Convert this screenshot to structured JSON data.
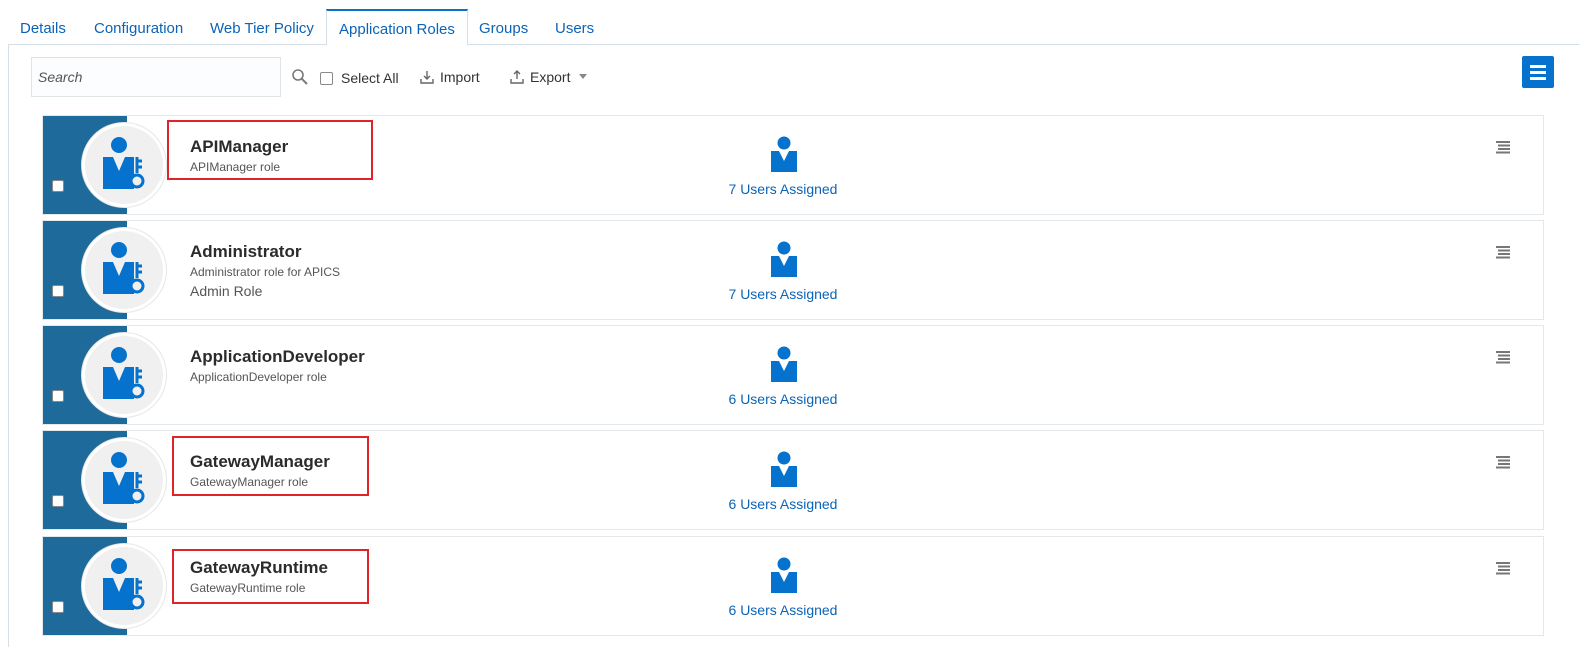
{
  "tabs": [
    {
      "label": "Details",
      "active": false
    },
    {
      "label": "Configuration",
      "active": false
    },
    {
      "label": "Web Tier Policy",
      "active": false
    },
    {
      "label": "Application Roles",
      "active": true
    },
    {
      "label": "Groups",
      "active": false
    },
    {
      "label": "Users",
      "active": false
    }
  ],
  "toolbar": {
    "search_placeholder": "Search",
    "search_value": "",
    "select_all_label": "Select All",
    "select_all_checked": false,
    "import_label": "Import",
    "export_label": "Export"
  },
  "roles": [
    {
      "name": "APIManager",
      "description": "APIManager role",
      "extra": "",
      "assigned": "7 Users Assigned",
      "checked": false,
      "highlighted": true
    },
    {
      "name": "Administrator",
      "description": "Administrator role for APICS",
      "extra": "Admin Role",
      "assigned": "7 Users Assigned",
      "checked": false,
      "highlighted": false
    },
    {
      "name": "ApplicationDeveloper",
      "description": "ApplicationDeveloper role",
      "extra": "",
      "assigned": "6 Users Assigned",
      "checked": false,
      "highlighted": false
    },
    {
      "name": "GatewayManager",
      "description": "GatewayManager role",
      "extra": "",
      "assigned": "6 Users Assigned",
      "checked": false,
      "highlighted": true
    },
    {
      "name": "GatewayRuntime",
      "description": "GatewayRuntime role",
      "extra": "",
      "assigned": "6 Users Assigned",
      "checked": false,
      "highlighted": true
    }
  ],
  "colors": {
    "accent": "#0572ce",
    "link": "#0b64b7",
    "card_band": "#1e6a9a",
    "highlight_box": "#e0232b"
  },
  "icons": {
    "search": "magnifier-icon",
    "import": "download-tray-icon",
    "export": "upload-tray-icon",
    "role_avatar": "user-key-icon",
    "assigned_users": "person-icon",
    "card_menu": "hamburger-icon",
    "view_menu": "list-view-icon"
  }
}
